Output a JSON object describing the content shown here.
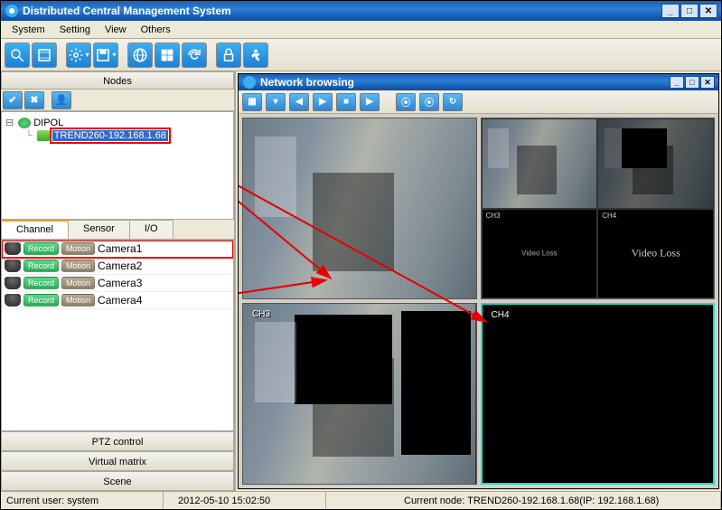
{
  "window": {
    "title": "Distributed Central Management System"
  },
  "menu": {
    "system": "System",
    "setting": "Setting",
    "view": "View",
    "others": "Others"
  },
  "left": {
    "nodes_header": "Nodes",
    "tree": {
      "root": "DIPOL",
      "child": "TREND260-192.168.1.68"
    },
    "tabs": {
      "channel": "Channel",
      "sensor": "Sensor",
      "io": "I/O"
    },
    "cams": [
      {
        "record": "Record",
        "motion": "Motion",
        "name": "Camera1"
      },
      {
        "record": "Record",
        "motion": "Motion",
        "name": "Camera2"
      },
      {
        "record": "Record",
        "motion": "Motion",
        "name": "Camera3"
      },
      {
        "record": "Record",
        "motion": "Motion",
        "name": "Camera4"
      }
    ],
    "ptz": "PTZ control",
    "virtual_matrix": "Virtual matrix",
    "scene": "Scene"
  },
  "inner": {
    "title": "Network browsing"
  },
  "cells": {
    "ch3": "CH3",
    "ch4": "CH4",
    "q_ch3": "CH3",
    "q_ch4": "CH4",
    "q_videoloss_small": "Video Loss",
    "q_videoloss_big": "Video Loss"
  },
  "status": {
    "user": "Current user: system",
    "time": "2012-05-10 15:02:50",
    "node": "Current node: TREND260-192.168.1.68(IP: 192.168.1.68)"
  }
}
